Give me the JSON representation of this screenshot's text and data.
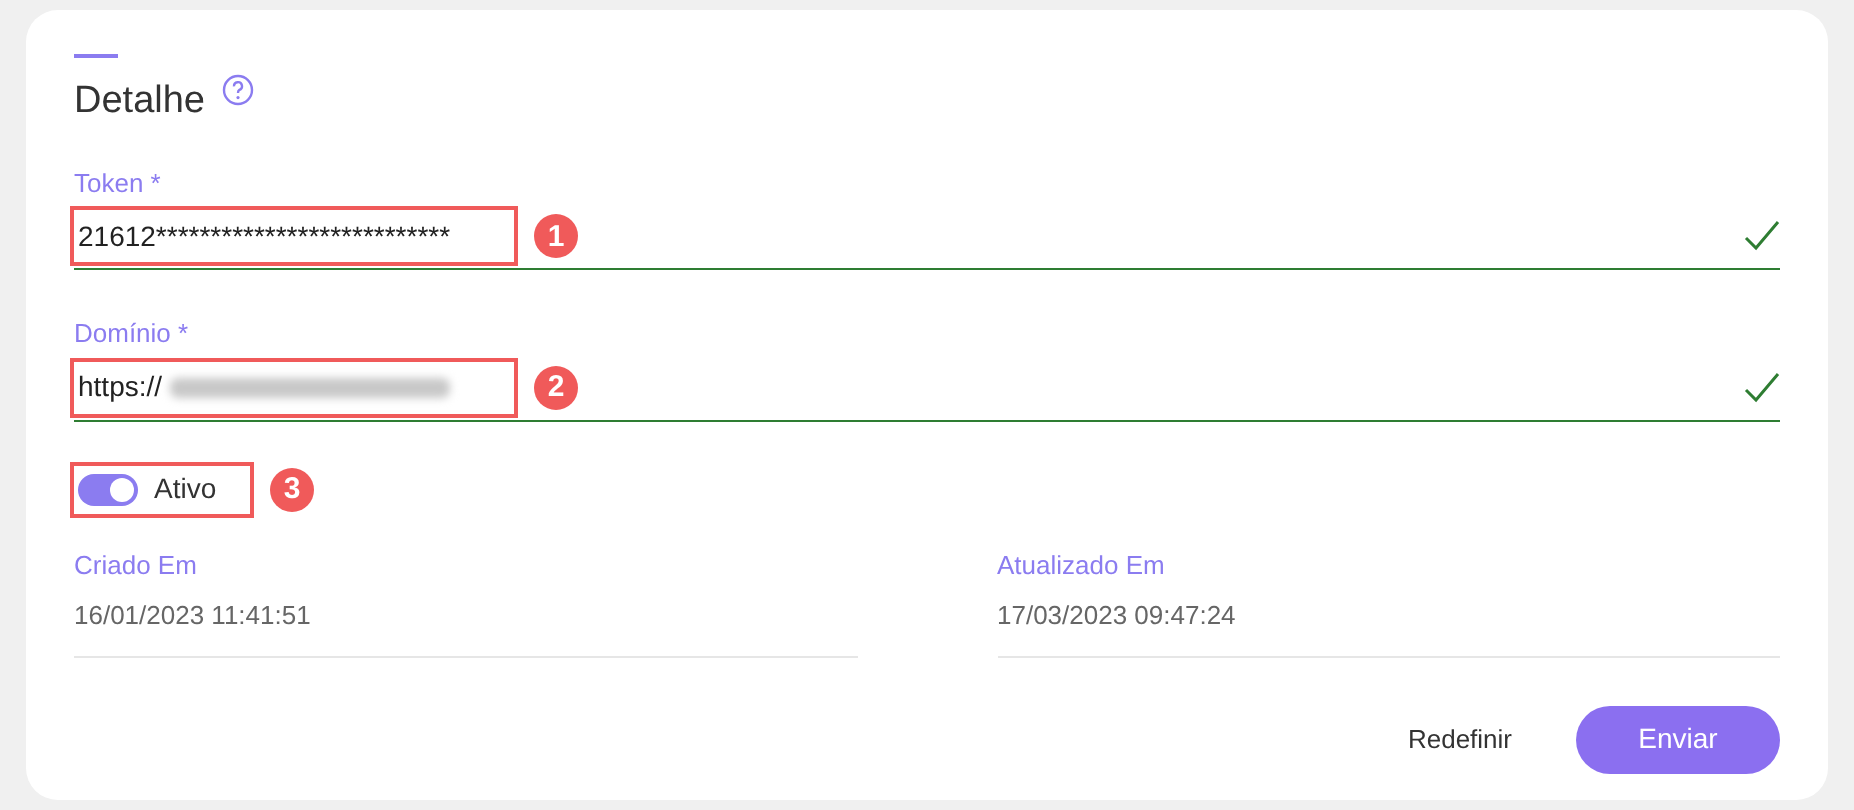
{
  "section": {
    "title": "Detalhe"
  },
  "fields": [
    {
      "label": "Token *",
      "value": "21612***************************",
      "valid": true,
      "redacted": false,
      "callout": "1"
    },
    {
      "label": "Domínio *",
      "value": "https://",
      "valid": true,
      "redacted": true,
      "callout": "2"
    }
  ],
  "toggle": {
    "label": "Ativo",
    "on": true,
    "callout": "3"
  },
  "info": [
    {
      "label": "Criado Em",
      "value": "16/01/2023 11:41:51"
    },
    {
      "label": "Atualizado Em",
      "value": "17/03/2023 09:47:24"
    }
  ],
  "buttons": [
    {
      "label": "Redefinir",
      "kind": "text"
    },
    {
      "label": "Enviar",
      "kind": "primary"
    }
  ]
}
